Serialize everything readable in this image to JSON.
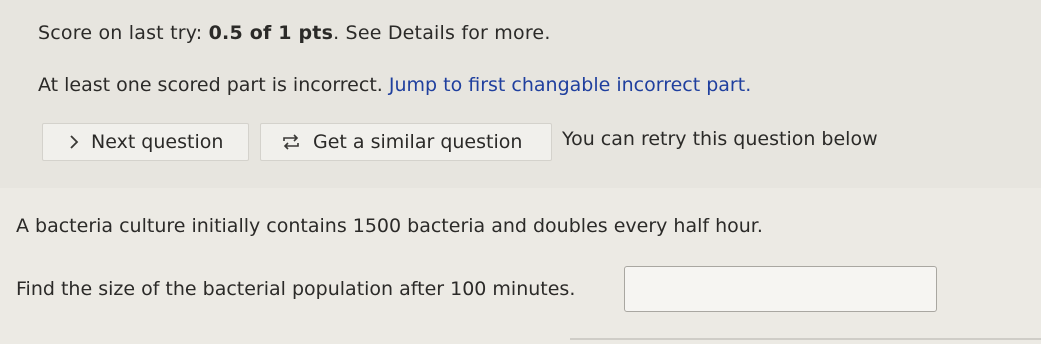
{
  "score": {
    "prefix": "Score on last try: ",
    "score_value": "0.5 of 1 pts",
    "suffix": ". See Details for more."
  },
  "feedback": {
    "text": "At least one scored part is incorrect. ",
    "jump_link": "Jump to first changable incorrect part."
  },
  "actions": {
    "next_label": "Next question",
    "similar_label": "Get a similar question",
    "retry_text": "You can retry this question below"
  },
  "question": {
    "line1": "A bacteria culture initially contains 1500 bacteria and doubles every half hour.",
    "line2": "Find the size of the bacterial population after 100 minutes.",
    "answer_value": ""
  }
}
